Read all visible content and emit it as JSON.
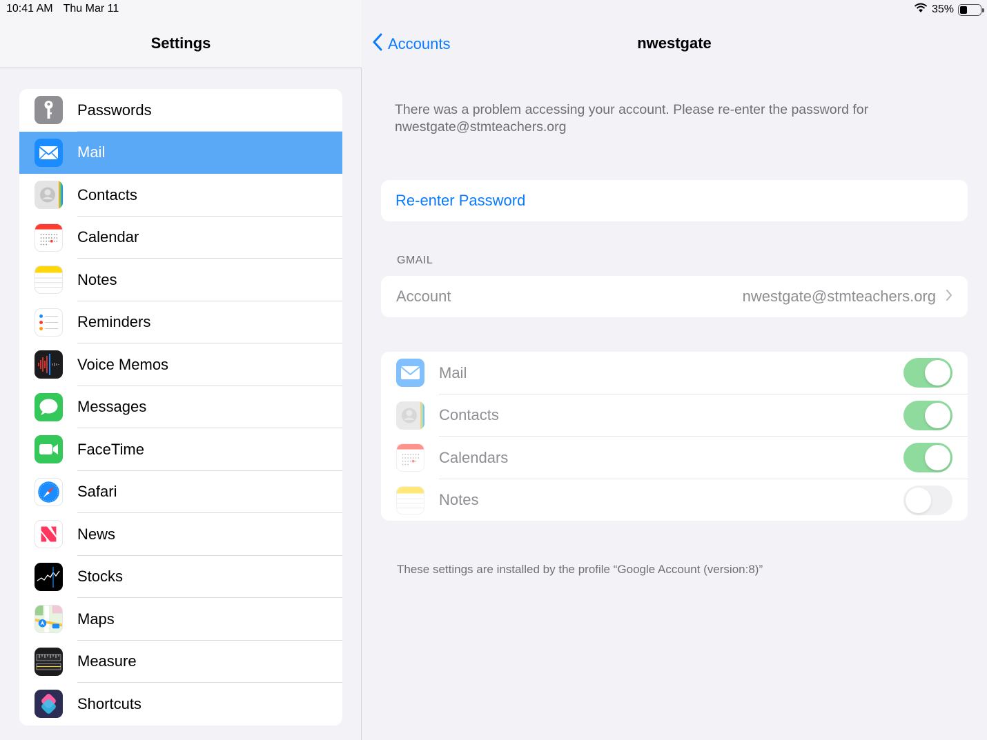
{
  "status": {
    "time": "10:41 AM",
    "date": "Thu Mar 11",
    "battery": "35%",
    "battery_level": 0.35
  },
  "sidebar": {
    "title": "Settings",
    "items": [
      {
        "label": "Passwords",
        "icon": "key-icon",
        "color": "#8e8e93"
      },
      {
        "label": "Mail",
        "icon": "mail-icon",
        "color": "#1a8cff",
        "selected": true
      },
      {
        "label": "Contacts",
        "icon": "contacts-icon",
        "color": "#d8d8d8"
      },
      {
        "label": "Calendar",
        "icon": "calendar-icon",
        "color": "#ffffff"
      },
      {
        "label": "Notes",
        "icon": "notes-icon",
        "color": "#ffffff"
      },
      {
        "label": "Reminders",
        "icon": "reminders-icon",
        "color": "#ffffff"
      },
      {
        "label": "Voice Memos",
        "icon": "voice-memos-icon",
        "color": "#1c1c1e"
      },
      {
        "label": "Messages",
        "icon": "messages-icon",
        "color": "#34c759"
      },
      {
        "label": "FaceTime",
        "icon": "facetime-icon",
        "color": "#34c759"
      },
      {
        "label": "Safari",
        "icon": "safari-icon",
        "color": "#ffffff"
      },
      {
        "label": "News",
        "icon": "news-icon",
        "color": "#ffffff"
      },
      {
        "label": "Stocks",
        "icon": "stocks-icon",
        "color": "#000000"
      },
      {
        "label": "Maps",
        "icon": "maps-icon",
        "color": "#ffffff"
      },
      {
        "label": "Measure",
        "icon": "measure-icon",
        "color": "#1c1c1e"
      },
      {
        "label": "Shortcuts",
        "icon": "shortcuts-icon",
        "color": "#2c2c54"
      }
    ]
  },
  "detail": {
    "back_label": "Accounts",
    "title": "nwestgate",
    "notice": "There was a problem accessing your account. Please re-enter the password for nwestgate@stmteachers.org",
    "reenter_label": "Re-enter Password",
    "section_label": "GMAIL",
    "account_label": "Account",
    "account_value": "nwestgate@stmteachers.org",
    "services": [
      {
        "label": "Mail",
        "icon": "mail-icon",
        "on": true
      },
      {
        "label": "Contacts",
        "icon": "contacts-icon",
        "on": true
      },
      {
        "label": "Calendars",
        "icon": "calendar-icon",
        "on": true
      },
      {
        "label": "Notes",
        "icon": "notes-icon",
        "on": false
      }
    ],
    "footer": "These settings are installed by the profile “Google Account (version:8)”"
  },
  "colors": {
    "accent": "#0a7aff",
    "selected_row": "#5aa9f7",
    "toggle_on": "#8fdb9e"
  }
}
